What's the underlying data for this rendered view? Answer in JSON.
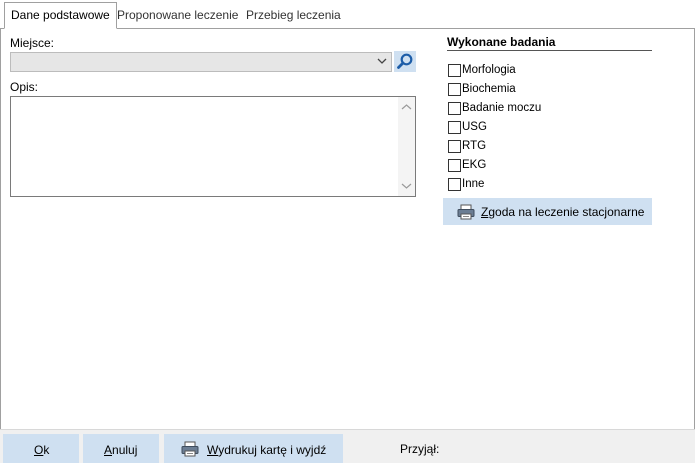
{
  "tabs": [
    {
      "label": "Dane podstawowe",
      "active": true
    },
    {
      "label": "Proponowane leczenie",
      "active": false
    },
    {
      "label": "Przebieg leczenia",
      "active": false
    }
  ],
  "form": {
    "place_label": "Miejsce:",
    "place_value": "",
    "description_label": "Opis:",
    "description_value": ""
  },
  "tests": {
    "title": "Wykonane badania",
    "items": [
      {
        "label": "Morfologia",
        "checked": false
      },
      {
        "label": "Biochemia",
        "checked": false
      },
      {
        "label": "Badanie moczu",
        "checked": false
      },
      {
        "label": "USG",
        "checked": false
      },
      {
        "label": "RTG",
        "checked": false
      },
      {
        "label": "EKG",
        "checked": false
      },
      {
        "label": "Inne",
        "checked": false
      }
    ],
    "consent_button": {
      "label": "Zgoda na leczenie stacjonarne",
      "accel": "Z",
      "rest": "goda na leczenie stacjonarne"
    }
  },
  "footer": {
    "ok": {
      "label": "Ok",
      "accel": "O",
      "rest": "k"
    },
    "cancel": {
      "label": "Anuluj",
      "accel": "A",
      "rest": "nuluj"
    },
    "print": {
      "label": "Wydrukuj kartę i wyjdź",
      "accel": "W",
      "rest": "ydrukuj kartę i wyjdź"
    },
    "received_label": "Przyjął:"
  },
  "icons": {
    "search": "magnifier-icon",
    "dropdown": "chevron-down-icon",
    "printer": "printer-icon",
    "accent": "#cfe0f1",
    "icon_blue": "#1d5da8"
  }
}
